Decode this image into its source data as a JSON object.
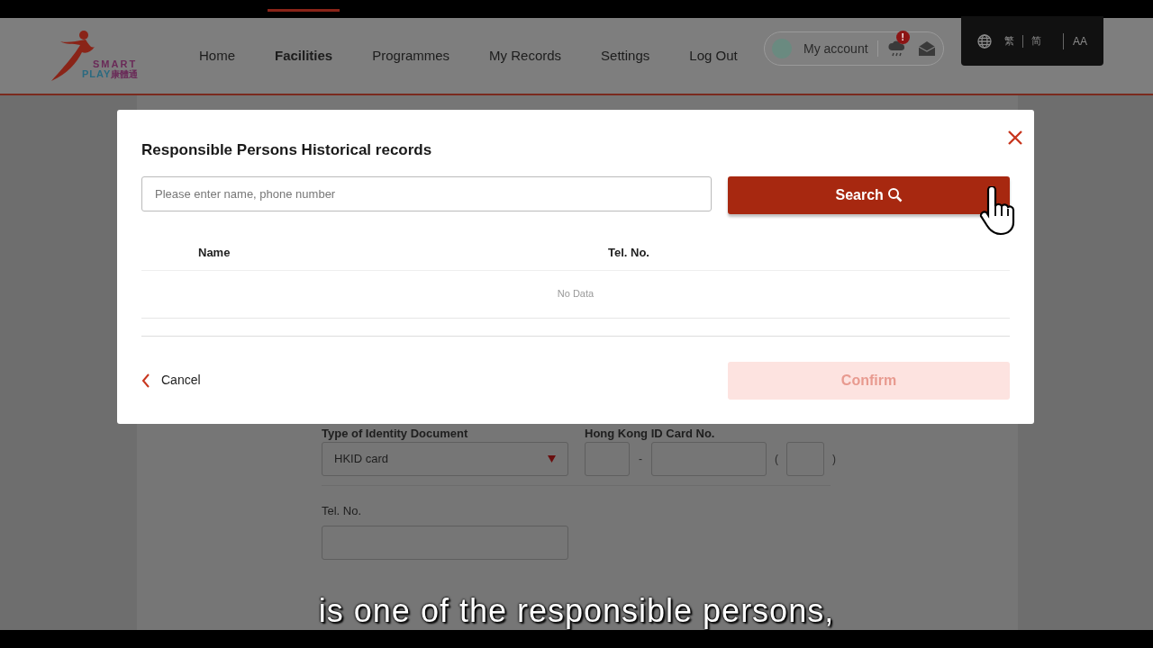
{
  "header": {
    "logo": {
      "top": "SMART",
      "bottom": "PLAY",
      "chinese": "康體通"
    },
    "nav": [
      {
        "label": "Home",
        "selected": false
      },
      {
        "label": "Facilities",
        "selected": true
      },
      {
        "label": "Programmes",
        "selected": false
      },
      {
        "label": "My Records",
        "selected": false
      },
      {
        "label": "Settings",
        "selected": false
      },
      {
        "label": "Log Out",
        "selected": false
      }
    ],
    "account": {
      "label": "My account",
      "badge": "!"
    },
    "language": {
      "options": [
        "繁",
        "简"
      ],
      "font_size": "AA"
    }
  },
  "form": {
    "id_type": {
      "label": "Type of Identity Document",
      "value": "HKID card"
    },
    "id_number": {
      "label": "Hong Kong ID Card No.",
      "separator": "-",
      "open": "(",
      "close": ")"
    },
    "tel": {
      "label": "Tel. No."
    }
  },
  "modal": {
    "title": "Responsible Persons Historical records",
    "search": {
      "placeholder": "Please enter name, phone number",
      "button": "Search"
    },
    "table": {
      "columns": [
        "Name",
        "Tel. No."
      ],
      "empty": "No Data"
    },
    "cancel": "Cancel",
    "confirm": {
      "label": "Confirm",
      "disabled": true
    }
  },
  "subtitle": "is one of the responsible persons,"
}
